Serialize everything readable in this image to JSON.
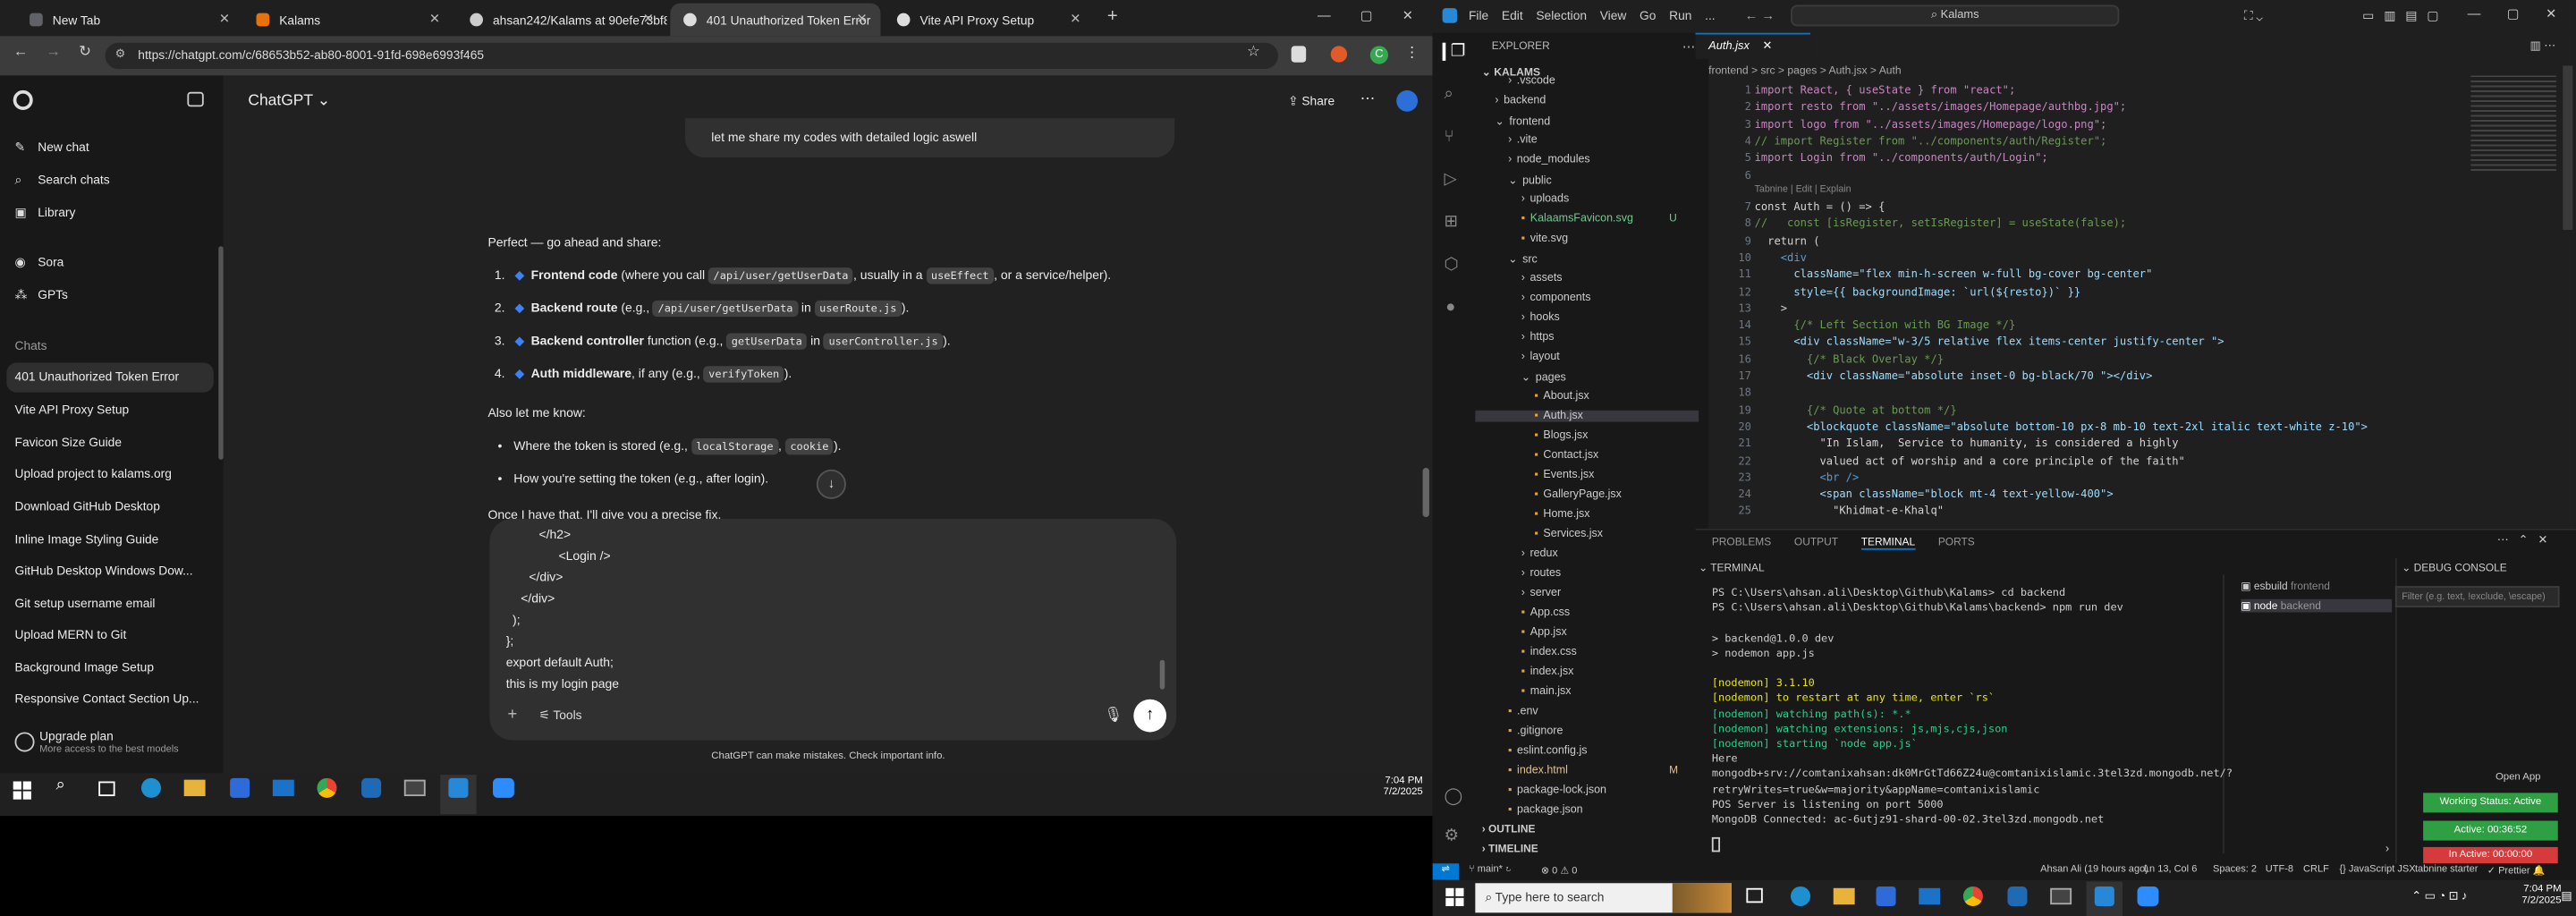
{
  "chrome": {
    "tabs": [
      {
        "label": "New Tab",
        "color": "#5f6368"
      },
      {
        "label": "Kalams",
        "color": "#e8710a"
      },
      {
        "label": "ahsan242/Kalams at 90efe73bf8",
        "color": "#cccccc"
      },
      {
        "label": "401 Unauthorized Token Error",
        "color": "#10a37f"
      },
      {
        "label": "Vite API Proxy Setup",
        "color": "#10a37f"
      }
    ],
    "url": "https://chatgpt.com/c/68653b52-ab80-8001-91fd-698e6993f465"
  },
  "chatgpt": {
    "sidebar_items": [
      {
        "label": "New chat",
        "icon": "compose-icon"
      },
      {
        "label": "Search chats",
        "icon": "search-icon"
      },
      {
        "label": "Library",
        "icon": "library-icon"
      },
      {
        "label": "Sora",
        "icon": "sora-icon"
      },
      {
        "label": "GPTs",
        "icon": "gpts-icon"
      }
    ],
    "chats_heading": "Chats",
    "chats": [
      "401 Unauthorized Token Error",
      "Vite API Proxy Setup",
      "Favicon Size Guide",
      "Upload project to kalams.org",
      "Download GitHub Desktop",
      "Inline Image Styling Guide",
      "GitHub Desktop Windows Dow...",
      "Git setup username email",
      "Upload MERN to Git",
      "Background Image Setup",
      "Responsive Contact Section Up..."
    ],
    "upgrade_title": "Upgrade plan",
    "upgrade_sub": "More access to the best models",
    "model": "ChatGPT",
    "share": "Share",
    "user_bubble": "let me share my codes with detailed logic aswell",
    "reply_intro": "Perfect — go ahead and share:",
    "numbered": [
      {
        "n": "1.",
        "bold": "Frontend code",
        "a": " (where you call ",
        "code1": "/api/user/getUserData",
        "b": ", usually in a ",
        "code2": "useEffect",
        "c": ", or a service/helper)."
      },
      {
        "n": "2.",
        "bold": "Backend route",
        "a": " (e.g., ",
        "code1": "/api/user/getUserData",
        "b": " in ",
        "code2": "userRoute.js",
        "c": ")."
      },
      {
        "n": "3.",
        "bold": "Backend controller",
        "a": " function (e.g., ",
        "code1": "getUserData",
        "b": " in ",
        "code2": "userController.js",
        "c": ")."
      },
      {
        "n": "4.",
        "bold": "Auth middleware",
        "a": ", if any (e.g., ",
        "code1": "verifyToken",
        "b": ").",
        "code2": "",
        "c": ""
      }
    ],
    "also": "Also let me know:",
    "bullets": [
      {
        "a": "Where the token is stored (e.g., ",
        "c1": "localStorage",
        "b": ", ",
        "c2": "cookie",
        "c": ")."
      },
      {
        "a": "How you're setting the token (e.g., after login).",
        "c1": "",
        "b": "",
        "c2": "",
        "c": ""
      }
    ],
    "cutoff": "Once I have that, I'll give you a precise fix.",
    "input_lines": [
      "</h2>",
      "<Login />",
      "</div>",
      "</div>",
      ");",
      "};",
      "export default Auth;",
      "this is my login page"
    ],
    "tools": "Tools",
    "disclaimer": "ChatGPT can make mistakes. Check important info."
  },
  "taskbar_left": {
    "time": "7:04 PM",
    "date": "7/2/2025"
  },
  "vscode": {
    "menu": [
      "File",
      "Edit",
      "Selection",
      "View",
      "Go",
      "Run",
      "..."
    ],
    "search": "Kalams",
    "explorer_title": "EXPLORER",
    "root": "KALAMS",
    "tree": [
      {
        "t": ".vscode",
        "d": 2,
        "k": "folder"
      },
      {
        "t": "backend",
        "d": 1,
        "k": "folder"
      },
      {
        "t": "frontend",
        "d": 1,
        "k": "folder-open"
      },
      {
        "t": ".vite",
        "d": 2,
        "k": "folder"
      },
      {
        "t": "node_modules",
        "d": 2,
        "k": "folder"
      },
      {
        "t": "public",
        "d": 2,
        "k": "folder-open"
      },
      {
        "t": "uploads",
        "d": 3,
        "k": "folder"
      },
      {
        "t": "KalaamsFavicon.svg",
        "d": 3,
        "k": "file",
        "badge": "U"
      },
      {
        "t": "vite.svg",
        "d": 3,
        "k": "file"
      },
      {
        "t": "src",
        "d": 2,
        "k": "folder-open"
      },
      {
        "t": "assets",
        "d": 3,
        "k": "folder"
      },
      {
        "t": "components",
        "d": 3,
        "k": "folder"
      },
      {
        "t": "hooks",
        "d": 3,
        "k": "folder"
      },
      {
        "t": "https",
        "d": 3,
        "k": "folder"
      },
      {
        "t": "layout",
        "d": 3,
        "k": "folder"
      },
      {
        "t": "pages",
        "d": 3,
        "k": "folder-open"
      },
      {
        "t": "About.jsx",
        "d": 4,
        "k": "file"
      },
      {
        "t": "Auth.jsx",
        "d": 4,
        "k": "file",
        "sel": true
      },
      {
        "t": "Blogs.jsx",
        "d": 4,
        "k": "file"
      },
      {
        "t": "Contact.jsx",
        "d": 4,
        "k": "file"
      },
      {
        "t": "Events.jsx",
        "d": 4,
        "k": "file"
      },
      {
        "t": "GalleryPage.jsx",
        "d": 4,
        "k": "file"
      },
      {
        "t": "Home.jsx",
        "d": 4,
        "k": "file"
      },
      {
        "t": "Services.jsx",
        "d": 4,
        "k": "file"
      },
      {
        "t": "redux",
        "d": 3,
        "k": "folder"
      },
      {
        "t": "routes",
        "d": 3,
        "k": "folder"
      },
      {
        "t": "server",
        "d": 3,
        "k": "folder"
      },
      {
        "t": "App.css",
        "d": 3,
        "k": "file"
      },
      {
        "t": "App.jsx",
        "d": 3,
        "k": "file"
      },
      {
        "t": "index.css",
        "d": 3,
        "k": "file"
      },
      {
        "t": "index.jsx",
        "d": 3,
        "k": "file"
      },
      {
        "t": "main.jsx",
        "d": 3,
        "k": "file"
      },
      {
        "t": ".env",
        "d": 2,
        "k": "file"
      },
      {
        "t": ".gitignore",
        "d": 2,
        "k": "file"
      },
      {
        "t": "eslint.config.js",
        "d": 2,
        "k": "file"
      },
      {
        "t": "index.html",
        "d": 2,
        "k": "file",
        "badge": "M"
      },
      {
        "t": "package-lock.json",
        "d": 2,
        "k": "file"
      },
      {
        "t": "package.json",
        "d": 2,
        "k": "file"
      }
    ],
    "outline": "OUTLINE",
    "timeline": "TIMELINE",
    "editor_tab": "Auth.jsx",
    "breadcrumb": "frontend > src > pages > Auth.jsx > Auth",
    "codelens": "Tabnine | Edit | Explain",
    "code": [
      "import React, { useState } from \"react\";",
      "import resto from \"../assets/images/Homepage/authbg.jpg\";",
      "import logo from \"../assets/images/Homepage/logo.png\";",
      "// import Register from \"../components/auth/Register\";",
      "import Login from \"../components/auth/Login\";",
      "",
      "const Auth = () => {",
      "//   const [isRegister, setIsRegister] = useState(false);",
      "  return (",
      "    <div",
      "      className=\"flex min-h-screen w-full bg-cover bg-center\"",
      "      style={{ backgroundImage: `url(${resto})` }}",
      "    >",
      "      {/* Left Section with BG Image */}",
      "      <div className=\"w-3/5 relative flex items-center justify-center \">",
      "        {/* Black Overlay */}",
      "        <div className=\"absolute inset-0 bg-black/70 \"></div>",
      "",
      "        {/* Quote at bottom */}",
      "        <blockquote className=\"absolute bottom-10 px-8 mb-10 text-2xl italic text-white z-10\">",
      "          \"In Islam,  Service to humanity, is considered a highly",
      "          valued act of worship and a core principle of the faith\"",
      "          <br />",
      "          <span className=\"block mt-4 text-yellow-400\">",
      "            \"Khidmat-e-Khalq\""
    ],
    "panel_tabs": [
      "PROBLEMS",
      "OUTPUT",
      "TERMINAL",
      "PORTS"
    ],
    "terminal_title": "TERMINAL",
    "terminal": [
      "PS C:\\Users\\ahsan.ali\\Desktop\\Github\\Kalams> cd backend",
      "PS C:\\Users\\ahsan.ali\\Desktop\\Github\\Kalams\\backend> npm run dev",
      "",
      "> backend@1.0.0 dev",
      "> nodemon app.js",
      "",
      "[nodemon] 3.1.10",
      "[nodemon] to restart at any time, enter `rs`",
      "[nodemon] watching path(s): *.*",
      "[nodemon] watching extensions: js,mjs,cjs,json",
      "[nodemon] starting `node app.js`",
      "Here",
      "mongodb+srv://comtanixahsan:dk0MrGtTd66Z24u@comtanixislamic.3tel3zd.mongodb.net/?",
      "retryWrites=true&w=majority&appName=comtanixislamic",
      "POS Server is listening on port 5000",
      "MongoDB Connected: ac-6utjz91-shard-00-02.3tel3zd.mongodb.net"
    ],
    "term_sessions": [
      {
        "name": "esbuild",
        "sub": "frontend"
      },
      {
        "name": "node",
        "sub": "backend"
      }
    ],
    "debug_title": "DEBUG CONSOLE",
    "debug_filter": "Filter (e.g. text, !exclude, \\escape)",
    "open_app": "Open App",
    "working": "Working Status: Active",
    "active": "Active: 00:36:52",
    "inactive": "In Active: 00:00:00",
    "status": {
      "branch": "main*",
      "errors": "0 ⚠ 0",
      "blame": "Ahsan Ali (19 hours ago)",
      "pos": "Ln 13, Col 6",
      "spaces": "Spaces: 2",
      "enc": "UTF-8",
      "eol": "CRLF",
      "lang": "JavaScript JSX",
      "tabnine": "tabnine starter",
      "prettier": "Prettier"
    }
  },
  "taskbar_right": {
    "search": "Type here to search",
    "time": "7:04 PM",
    "date": "7/2/2025"
  }
}
